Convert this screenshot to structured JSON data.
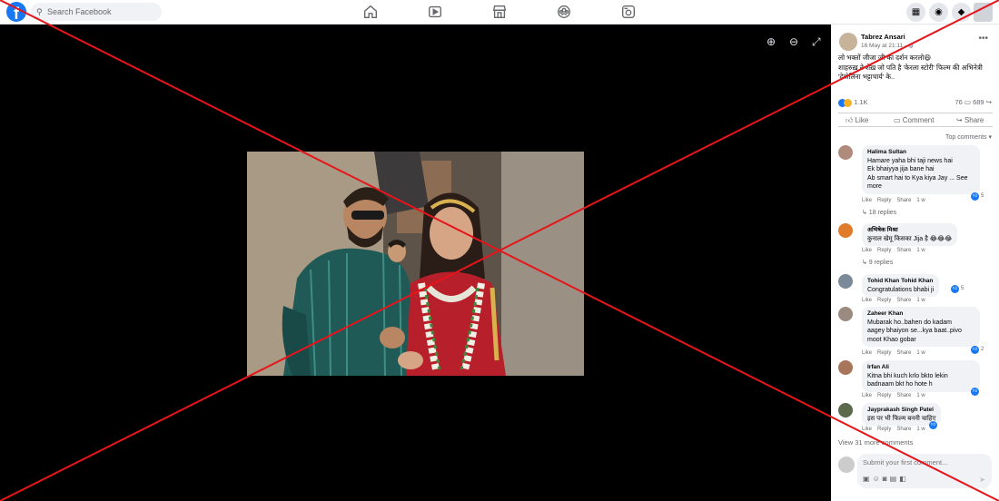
{
  "header": {
    "search_placeholder": "Search Facebook",
    "logo_letter": "f"
  },
  "photo_viewer": {
    "zoom_in": "⊕",
    "zoom_out": "⊖",
    "fullscreen": "⤢"
  },
  "post": {
    "author": "Tabrez Ansari",
    "time": "16 May at 21:11 · ",
    "caption_line1": "लो भक्तों जीजा जी का दर्शन करलो😄",
    "caption_line2": "शाहरुख़ ने शेख़ जो पति है 'केरला स्टोरी' फिल्म की अभिनेत्री 'देवोलिना भट्टाचार्य' के..",
    "reaction_count": "1.1K",
    "comment_count": "76",
    "share_count": "689",
    "like_label": "Like",
    "comment_label": "Comment",
    "share_label": "Share",
    "top_comments": "Top comments ▾"
  },
  "comments": [
    {
      "name": "Halima Sultan",
      "lines": [
        "Hamare yaha bhi taji news hai",
        "Ek bhaiyya jija bane hai",
        "Ab smart hai to Kya kiya Jay ... See more"
      ],
      "time": "1 w",
      "reactions": "5",
      "replies": "↳ 18 replies"
    },
    {
      "name": "अभिषेक मिश्रा",
      "lines": [
        "कुनाल खेमू किसका Jija है 😂😂😂"
      ],
      "time": "1 w",
      "reactions": "",
      "replies": "↳ 9 replies"
    },
    {
      "name": "Tohid Khan Tohid Khan",
      "lines": [
        "Congratulations bhabi ji"
      ],
      "time": "1 w",
      "reactions": "5",
      "replies": ""
    },
    {
      "name": "Zaheer Khan",
      "lines": [
        "Mubarak ho..bahen do kadam",
        "aagey bhaiyon se...kya baat..pivo",
        "moot Khao gobar"
      ],
      "time": "1 w",
      "reactions": "2",
      "replies": ""
    },
    {
      "name": "Irfan Ali",
      "lines": [
        "Kitna bhi kuch krlo bkto lekin",
        "badnaam bkt ho hote h"
      ],
      "time": "1 w",
      "reactions": "",
      "replies": ""
    },
    {
      "name": "Jayprakash Singh Patel",
      "lines": [
        "इस पर भी फिल्म बननी चाहिए"
      ],
      "time": "1 w",
      "reactions": "",
      "replies": ""
    }
  ],
  "comment_actions": {
    "like": "Like",
    "reply": "Reply",
    "share": "Share"
  },
  "view_more": "View 31 more comments",
  "composer": {
    "placeholder": "Submit your first comment..."
  }
}
